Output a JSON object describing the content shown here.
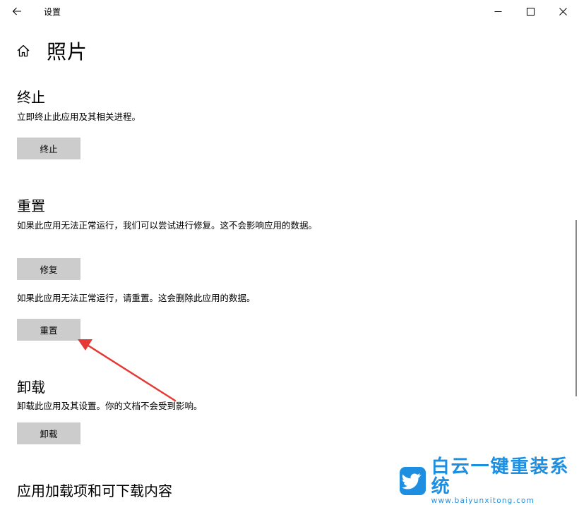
{
  "window": {
    "title": "设置",
    "back_icon": "arrow-left-icon",
    "minimize_icon": "minimize-icon",
    "maximize_icon": "maximize-icon",
    "close_icon": "close-icon"
  },
  "header": {
    "home_icon": "home-icon",
    "title": "照片"
  },
  "terminate": {
    "title": "终止",
    "description": "立即终止此应用及其相关进程。",
    "button_label": "终止"
  },
  "reset": {
    "title": "重置",
    "repair_description": "如果此应用无法正常运行，我们可以尝试进行修复。这不会影响应用的数据。",
    "repair_button_label": "修复",
    "reset_description": "如果此应用无法正常运行，请重置。这会删除此应用的数据。",
    "reset_button_label": "重置"
  },
  "uninstall": {
    "title": "卸载",
    "description": "卸载此应用及其设置。你的文档不会受到影响。",
    "button_label": "卸载"
  },
  "addons": {
    "title": "应用加载项和可下载内容"
  },
  "annotation": {
    "color": "#e53935"
  },
  "watermark": {
    "name": "白云一键重装系统",
    "url": "www.baiyunxitong.com",
    "color": "#1e8fe0",
    "logo_icon": "bird-logo-icon"
  },
  "colors": {
    "button_bg": "#cccccc",
    "background": "#ffffff"
  }
}
